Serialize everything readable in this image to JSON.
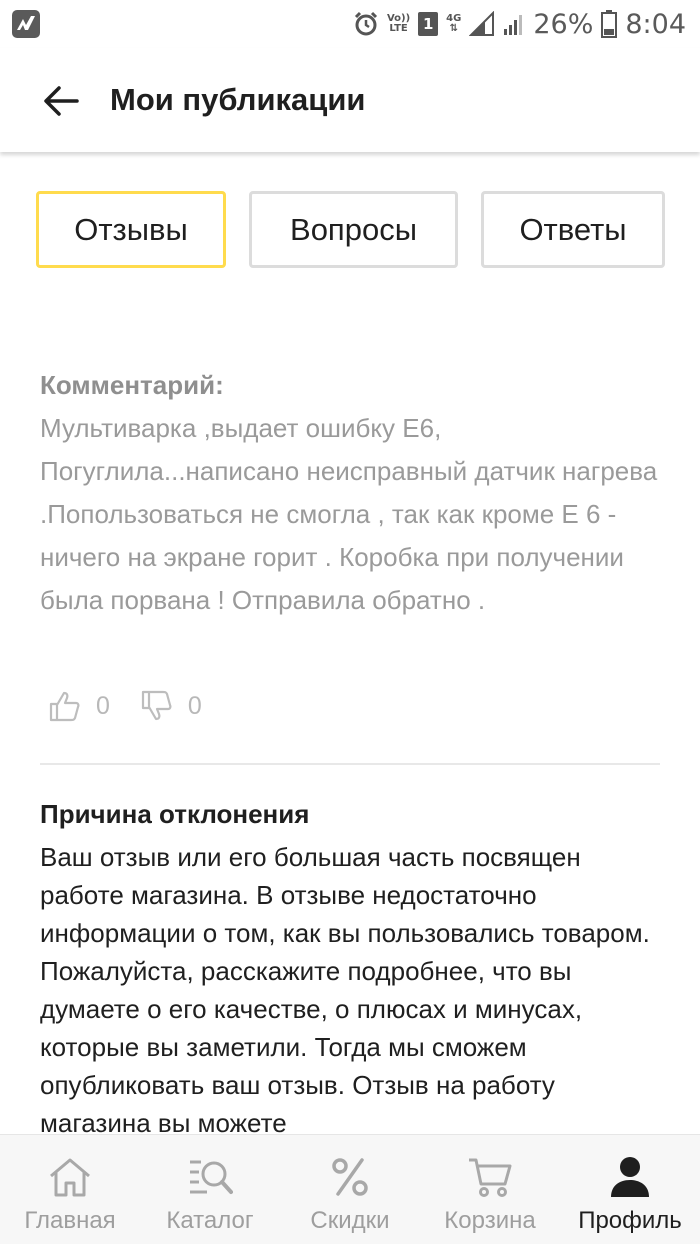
{
  "status_bar": {
    "volte_top": "Vo))",
    "volte_bottom": "LTE",
    "sim_slot": "1",
    "network": "4G",
    "battery": "26%",
    "time": "8:04",
    "icons": [
      "app-logo-icon",
      "alarm-icon",
      "sim-icon",
      "signal-icon",
      "battery-icon"
    ]
  },
  "header": {
    "title": "Мои публикации",
    "back_icon": "arrow-left-icon"
  },
  "tabs": [
    {
      "label": "Отзывы",
      "active": true
    },
    {
      "label": "Вопросы",
      "active": false
    },
    {
      "label": "Ответы",
      "active": false
    }
  ],
  "review": {
    "comment_label": "Комментарий:",
    "comment_text": "Мультиварка ,выдает ошибку Е6, Погуглила...написано неисправный датчик нагрева .Попользоваться не смогла , так как кроме Е 6 - ничего на экране горит . Коробка при получении была порвана ! Отправила обратно .",
    "likes": "0",
    "dislikes": "0"
  },
  "rejection": {
    "title": "Причина отклонения",
    "text": "Ваш отзыв или его большая часть посвящен работе магазина. В отзыве недостаточно информации о том, как вы пользовались товаром. Пожалуйста, расскажите подробнее, что вы думаете о его качестве, о плюсах и минусах, которые вы заметили. Тогда мы сможем опубликовать ваш отзыв. Отзыв на работу магазина вы можете"
  },
  "bottom_nav": [
    {
      "label": "Главная",
      "icon": "home-icon",
      "active": false
    },
    {
      "label": "Каталог",
      "icon": "catalog-search-icon",
      "active": false
    },
    {
      "label": "Скидки",
      "icon": "percent-icon",
      "active": false
    },
    {
      "label": "Корзина",
      "icon": "cart-icon",
      "active": false
    },
    {
      "label": "Профиль",
      "icon": "profile-icon",
      "active": true
    }
  ],
  "colors": {
    "active_tab_border": "#ffdb4d",
    "inactive_tab_border": "#dcdcdc",
    "muted_text": "#9a9a9a",
    "nav_inactive": "#9e9e9e",
    "nav_active": "#1f1f1f"
  }
}
